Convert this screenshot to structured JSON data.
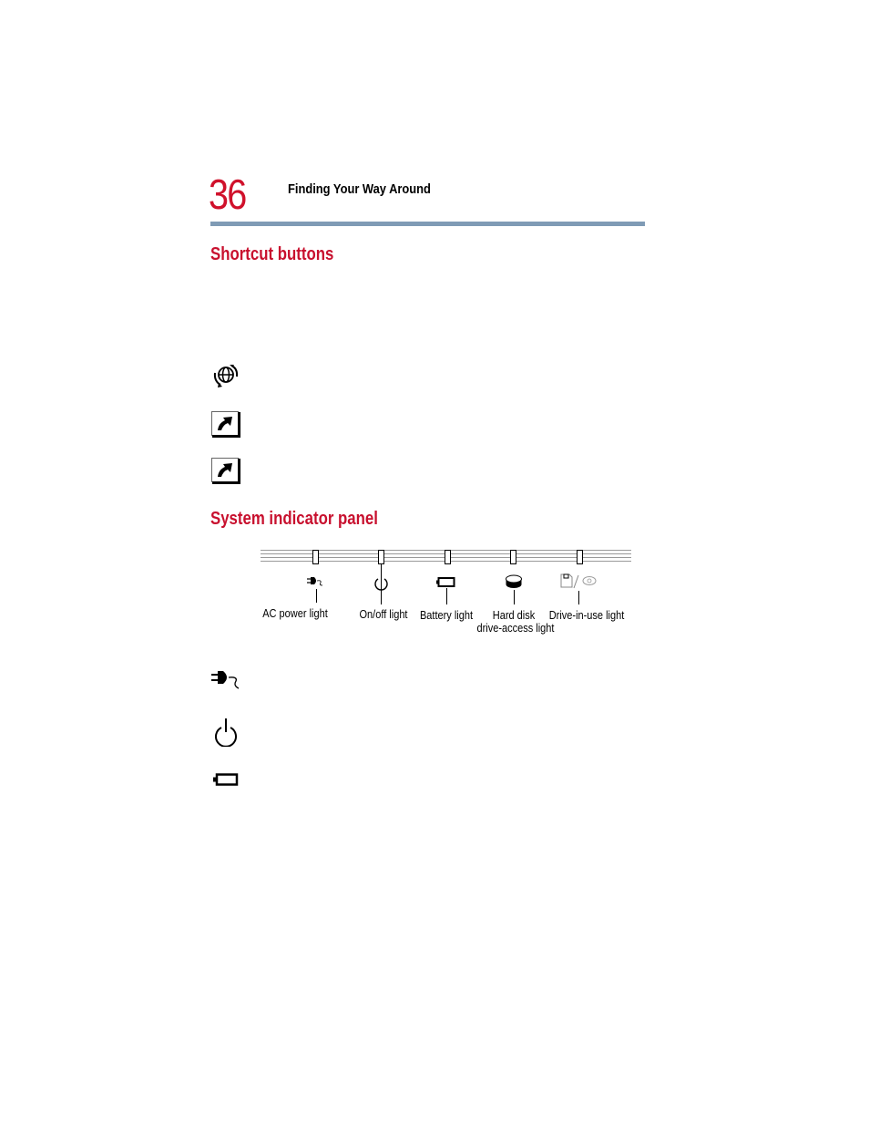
{
  "header": {
    "page_number": "36",
    "chapter_title": "Finding Your Way Around",
    "accent_color": "#c8102e",
    "rule_color": "#7f9bb5"
  },
  "sections": {
    "shortcut_buttons": {
      "heading": "Shortcut buttons",
      "icons": [
        "internet-globe-icon",
        "shortcut-arrow-icon",
        "shortcut-arrow-icon"
      ]
    },
    "system_indicator_panel": {
      "heading": "System indicator panel",
      "lights": [
        {
          "icon": "ac-power-plug-icon",
          "label": "AC power light"
        },
        {
          "icon": "power-icon",
          "label": "On/off light"
        },
        {
          "icon": "battery-icon",
          "label": "Battery light"
        },
        {
          "icon": "hard-disk-icon",
          "label_line1": "Hard disk",
          "label_line2": "drive-access light"
        },
        {
          "icon": "drive-in-use-icon",
          "label": "Drive-in-use light"
        }
      ],
      "legend_icons": [
        "ac-power-plug-icon",
        "power-icon",
        "battery-icon"
      ]
    }
  }
}
